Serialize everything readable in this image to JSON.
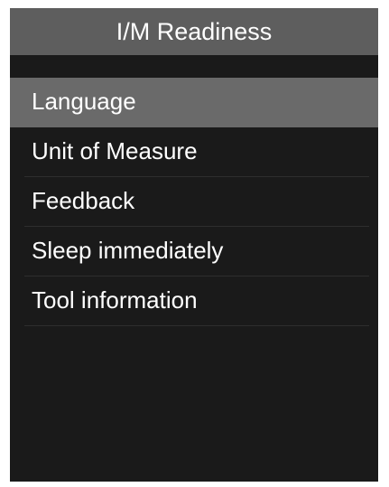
{
  "screen": {
    "title": "I/M Readiness",
    "selected_index": 0,
    "menu": [
      {
        "label": "Language"
      },
      {
        "label": "Unit of Measure"
      },
      {
        "label": "Feedback"
      },
      {
        "label": "Sleep immediately"
      },
      {
        "label": "Tool information"
      }
    ]
  },
  "colors": {
    "screen_background": "#1a1a1a",
    "title_bar": "#5e5e5e",
    "selected_item": "#6a6a6a",
    "text": "#ffffff"
  }
}
